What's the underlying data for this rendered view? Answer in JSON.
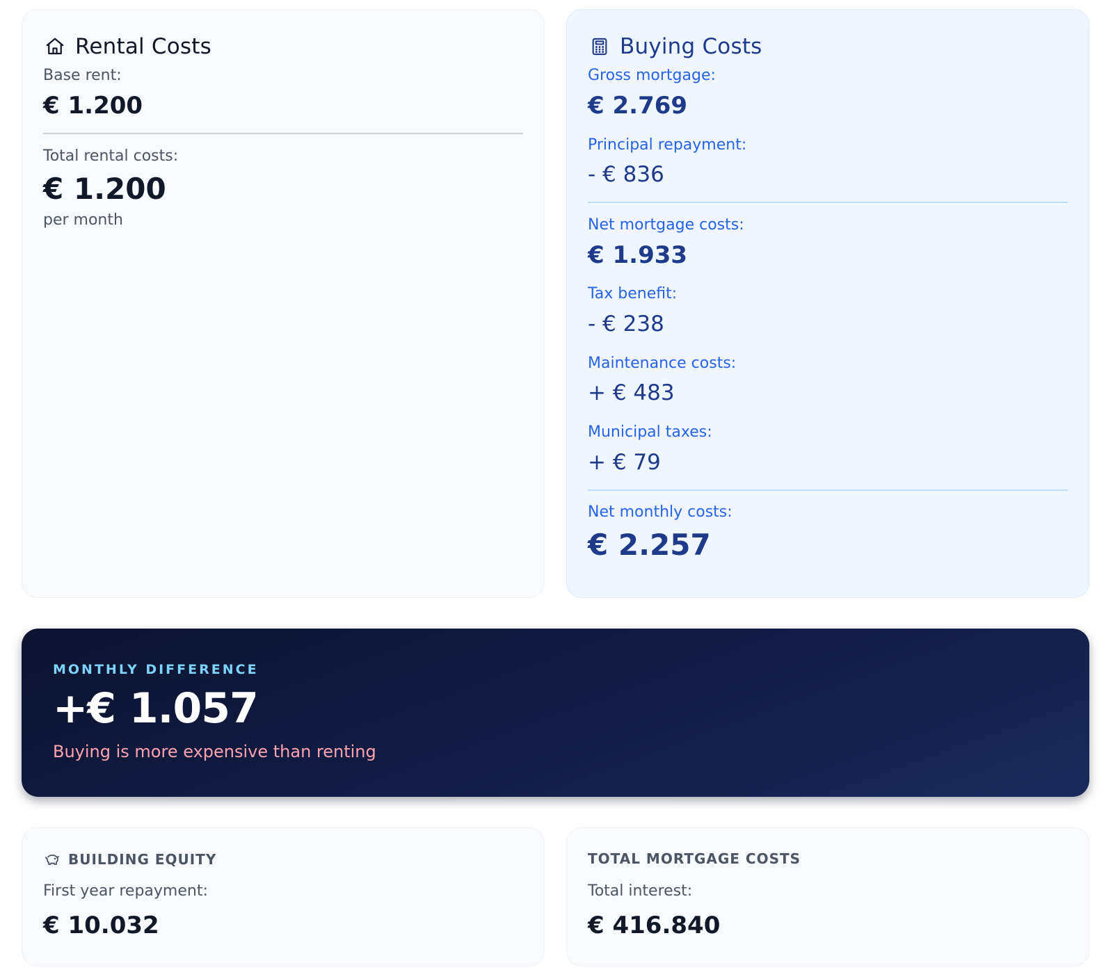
{
  "rental": {
    "title": "Rental Costs",
    "icon": "home-icon",
    "base_rent_label": "Base rent:",
    "base_rent_value": "€ 1.200",
    "total_label": "Total rental costs:",
    "total_value": "€ 1.200",
    "per_month": "per month"
  },
  "buying": {
    "title": "Buying Costs",
    "icon": "calculator-icon",
    "rows": [
      {
        "label": "Gross mortgage:",
        "value": "€ 2.769"
      },
      {
        "label": "Principal repayment:",
        "value": "- € 836"
      },
      {
        "label": "Net mortgage costs:",
        "value": "€ 1.933"
      },
      {
        "label": "Tax benefit:",
        "value": "- € 238"
      },
      {
        "label": "Maintenance costs:",
        "value": "+ € 483"
      },
      {
        "label": "Municipal taxes:",
        "value": "+ € 79"
      },
      {
        "label": "Net monthly costs:",
        "value": "€ 2.257"
      }
    ]
  },
  "difference": {
    "kicker": "MONTHLY DIFFERENCE",
    "value": "+€ 1.057",
    "note": "Buying is more expensive than renting"
  },
  "equity": {
    "icon": "piggy-bank-icon",
    "heading": "BUILDING EQUITY",
    "label": "First year repayment:",
    "value": "€ 10.032"
  },
  "totals": {
    "heading": "TOTAL MORTGAGE COSTS",
    "label": "Total interest:",
    "value": "€ 416.840"
  },
  "colors": {
    "rental_bg": "#f8fafc",
    "buying_bg": "#eff6ff",
    "buying_text": "#1e3a8a",
    "buying_label": "#2563eb",
    "banner_bg": "#0d1430",
    "kicker": "#7dd3fc",
    "negative_note": "#fda4af"
  }
}
